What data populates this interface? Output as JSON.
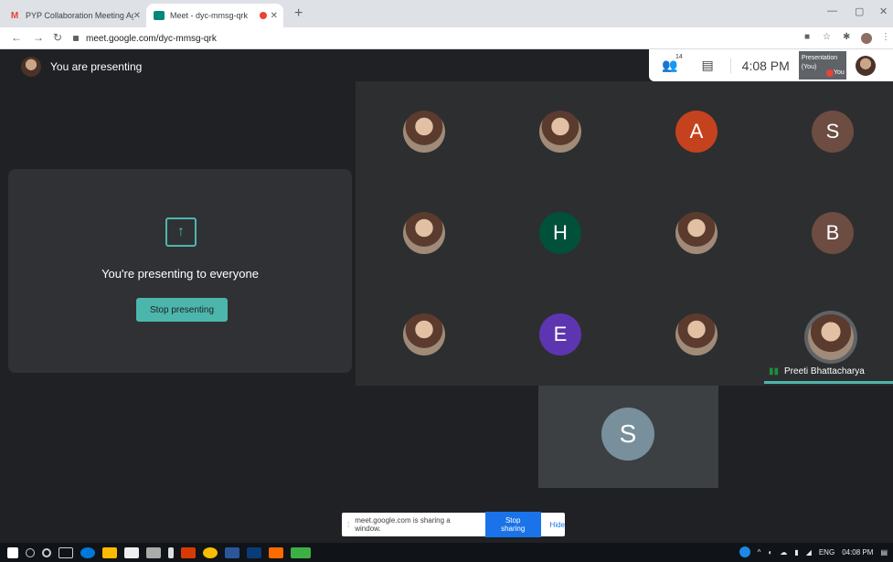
{
  "browser": {
    "tabs": [
      {
        "title": "PYP Collaboration Meeting Agen",
        "favicon": "gmail-icon",
        "active": false
      },
      {
        "title": "Meet - dyc-mmsg-qrk",
        "favicon": "meet-icon",
        "active": true
      }
    ],
    "new_tab": "+",
    "url": "meet.google.com/dyc-mmsg-qrk"
  },
  "meet": {
    "presenting_title": "You are presenting",
    "present_card": {
      "message": "You're presenting to everyone",
      "stop_label": "Stop presenting"
    },
    "info": {
      "participants_count": "14",
      "time": "4:08 PM",
      "thumb_title": "Presentation (You)",
      "thumb_you": "You"
    },
    "participants": [
      {
        "initial": "",
        "color": "",
        "photo": true
      },
      {
        "initial": "",
        "color": "",
        "photo": true
      },
      {
        "initial": "A",
        "color": "#c5421e",
        "photo": false
      },
      {
        "initial": "S",
        "color": "#6d4c41",
        "photo": false
      },
      {
        "initial": "",
        "color": "",
        "photo": true
      },
      {
        "initial": "H",
        "color": "#00503a",
        "photo": false
      },
      {
        "initial": "",
        "color": "",
        "photo": true
      },
      {
        "initial": "B",
        "color": "#6d4c41",
        "photo": false
      },
      {
        "initial": "",
        "color": "",
        "photo": true
      },
      {
        "initial": "E",
        "color": "#5e35b1",
        "photo": false
      },
      {
        "initial": "",
        "color": "",
        "photo": true
      },
      {
        "initial": "",
        "color": "",
        "photo": true
      }
    ],
    "active_speaker": "Preeti Bhattacharya",
    "extra_participant": {
      "initial": "S",
      "color": "#78909c"
    }
  },
  "share_bar": {
    "message": "meet.google.com is sharing a window.",
    "stop_label": "Stop sharing",
    "hide_label": "Hide"
  },
  "taskbar": {
    "language": "ENG",
    "time": "04:08 PM"
  }
}
